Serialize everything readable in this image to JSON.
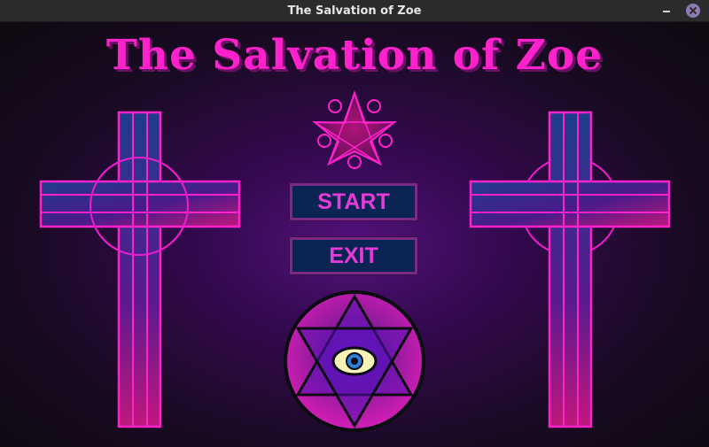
{
  "window": {
    "title": "The Salvation of Zoe"
  },
  "game": {
    "title": "The Salvation of Zoe",
    "buttons": {
      "start_label": "START",
      "exit_label": "EXIT"
    }
  },
  "icons": {
    "left_cross": "celtic-cross-icon",
    "right_cross": "celtic-cross-icon",
    "pentagram": "pentagram-icon",
    "hexagram_eye": "hexagram-eye-icon"
  },
  "colors": {
    "accent_magenta": "#ff22cc",
    "button_fill": "#0c2454",
    "button_border": "#7a2a86",
    "cross_fill": "#1e3a8a"
  }
}
